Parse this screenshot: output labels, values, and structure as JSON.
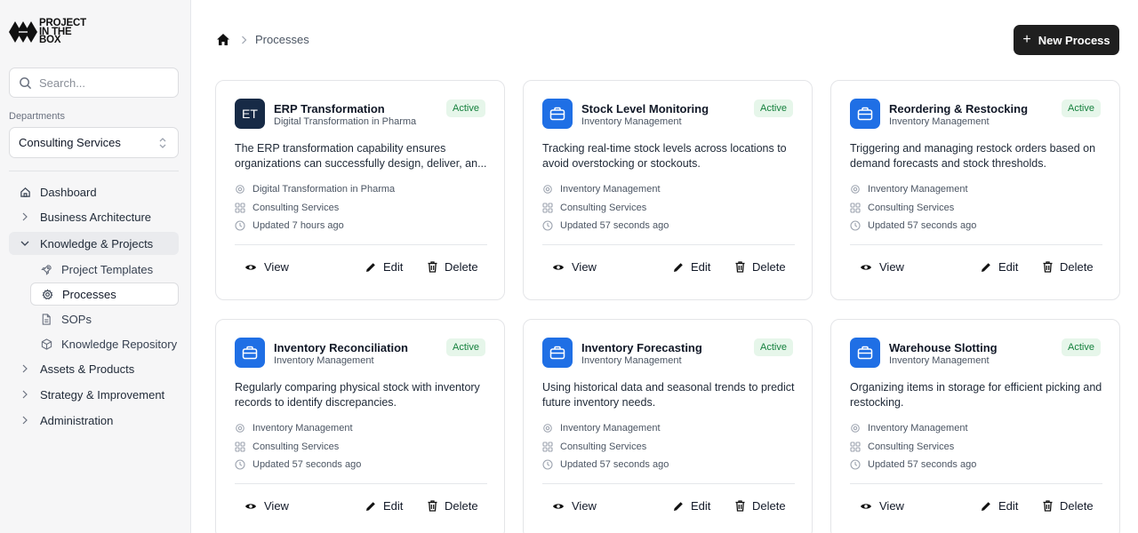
{
  "app": {
    "logo_lines": [
      "PROJECT",
      "IN THE",
      "BOX"
    ]
  },
  "sidebar": {
    "search_placeholder": "Search...",
    "departments_label": "Departments",
    "department_selected": "Consulting Services",
    "nav": [
      {
        "label": "Dashboard",
        "icon": "home-icon"
      },
      {
        "label": "Business Architecture",
        "icon": "chevron-right-icon"
      },
      {
        "label": "Knowledge & Projects",
        "icon": "chevron-down-icon",
        "expanded": true
      },
      {
        "label": "Assets & Products",
        "icon": "chevron-right-icon"
      },
      {
        "label": "Strategy & Improvement",
        "icon": "chevron-right-icon"
      },
      {
        "label": "Administration",
        "icon": "chevron-right-icon"
      }
    ],
    "subnav": [
      {
        "label": "Project Templates",
        "icon": "rocket-icon"
      },
      {
        "label": "Processes",
        "icon": "gear-icon",
        "active": true
      },
      {
        "label": "SOPs",
        "icon": "document-icon"
      },
      {
        "label": "Knowledge Repository",
        "icon": "cube-icon"
      }
    ]
  },
  "header": {
    "breadcrumb_current": "Processes",
    "new_button_label": "New Process"
  },
  "colors": {
    "accent_blue": "#1f6fe5",
    "dark_avatar": "#172a46",
    "badge_bg": "#e6f6ea",
    "badge_text": "#15803d",
    "primary_button": "#1f1f1f"
  },
  "cards": [
    {
      "avatar": "ET",
      "title": "ERP Transformation",
      "subtitle": "Digital Transformation in Pharma",
      "status": "Active",
      "description": "The ERP transformation capability ensures organizations can successfully design, deliver, an...",
      "category": "Digital Transformation in Pharma",
      "department": "Consulting Services",
      "updated": "Updated 7 hours ago",
      "view_label": "View",
      "edit_label": "Edit",
      "delete_label": "Delete"
    },
    {
      "avatar": "briefcase-icon",
      "title": "Stock Level Monitoring",
      "subtitle": "Inventory Management",
      "status": "Active",
      "description": "Tracking real-time stock levels across locations to avoid overstocking or stockouts.",
      "category": "Inventory Management",
      "department": "Consulting Services",
      "updated": "Updated 57 seconds ago",
      "view_label": "View",
      "edit_label": "Edit",
      "delete_label": "Delete"
    },
    {
      "avatar": "briefcase-icon",
      "title": "Reordering & Restocking",
      "subtitle": "Inventory Management",
      "status": "Active",
      "description": "Triggering and managing restock orders based on demand forecasts and stock thresholds.",
      "category": "Inventory Management",
      "department": "Consulting Services",
      "updated": "Updated 57 seconds ago",
      "view_label": "View",
      "edit_label": "Edit",
      "delete_label": "Delete"
    },
    {
      "avatar": "briefcase-icon",
      "title": "Inventory Reconciliation",
      "subtitle": "Inventory Management",
      "status": "Active",
      "description": "Regularly comparing physical stock with inventory records to identify discrepancies.",
      "category": "Inventory Management",
      "department": "Consulting Services",
      "updated": "Updated 57 seconds ago",
      "view_label": "View",
      "edit_label": "Edit",
      "delete_label": "Delete"
    },
    {
      "avatar": "briefcase-icon",
      "title": "Inventory Forecasting",
      "subtitle": "Inventory Management",
      "status": "Active",
      "description": "Using historical data and seasonal trends to predict future inventory needs.",
      "category": "Inventory Management",
      "department": "Consulting Services",
      "updated": "Updated 57 seconds ago",
      "view_label": "View",
      "edit_label": "Edit",
      "delete_label": "Delete"
    },
    {
      "avatar": "briefcase-icon",
      "title": "Warehouse Slotting",
      "subtitle": "Inventory Management",
      "status": "Active",
      "description": "Organizing items in storage for efficient picking and restocking.",
      "category": "Inventory Management",
      "department": "Consulting Services",
      "updated": "Updated 57 seconds ago",
      "view_label": "View",
      "edit_label": "Edit",
      "delete_label": "Delete"
    }
  ]
}
